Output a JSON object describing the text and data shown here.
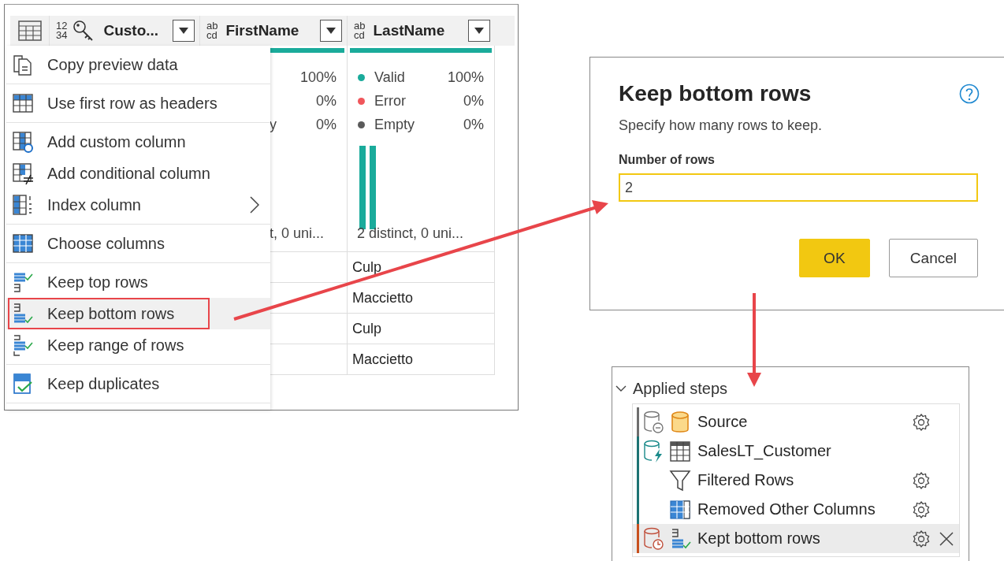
{
  "query_grid": {
    "columns": [
      {
        "type_lines": [
          "12",
          "34"
        ],
        "key": true,
        "name": "Custo..."
      },
      {
        "type_lines": [
          "ab",
          "cd"
        ],
        "key": false,
        "name": "FirstName",
        "quality": [
          {
            "pct": "100%"
          },
          {
            "pct": "0%"
          },
          {
            "label": "y",
            "pct": "0%"
          }
        ],
        "distinct": "t, 0 uni..."
      },
      {
        "type_lines": [
          "ab",
          "cd"
        ],
        "key": false,
        "name": "LastName",
        "quality": [
          {
            "label": "Valid",
            "color": "#1aab9b",
            "pct": "100%"
          },
          {
            "label": "Error",
            "color": "#f0565b",
            "pct": "0%"
          },
          {
            "label": "Empty",
            "color": "#5a5a5a",
            "pct": "0%"
          }
        ],
        "distinct": "2 distinct, 0 uni...",
        "cells": [
          "Culp",
          "Maccietto",
          "Culp",
          "Maccietto"
        ]
      }
    ]
  },
  "context_menu": {
    "groups": [
      [
        {
          "kind": "copy",
          "label": "Copy preview data",
          "submenu": false,
          "selected": false
        }
      ],
      [
        {
          "kind": "headers",
          "label": "Use first row as headers",
          "submenu": false,
          "selected": false
        }
      ],
      [
        {
          "kind": "custom",
          "label": "Add custom column",
          "submenu": false,
          "selected": false
        },
        {
          "kind": "conditional",
          "label": "Add conditional column",
          "submenu": false,
          "selected": false
        },
        {
          "kind": "index",
          "label": "Index column",
          "submenu": true,
          "selected": false
        }
      ],
      [
        {
          "kind": "choose",
          "label": "Choose columns",
          "submenu": false,
          "selected": false
        }
      ],
      [
        {
          "kind": "keep-top",
          "label": "Keep top rows",
          "submenu": false,
          "selected": false
        },
        {
          "kind": "keep-bottom",
          "label": "Keep bottom rows",
          "submenu": false,
          "selected": true
        },
        {
          "kind": "keep-range",
          "label": "Keep range of rows",
          "submenu": false,
          "selected": false
        }
      ],
      [
        {
          "kind": "duplicates",
          "label": "Keep duplicates",
          "submenu": false,
          "selected": false
        }
      ]
    ]
  },
  "dialog": {
    "title": "Keep bottom rows",
    "description": "Specify how many rows to keep.",
    "field_label": "Number of rows",
    "value": "2",
    "buttons": [
      {
        "label": "OK",
        "primary": true
      },
      {
        "label": "Cancel",
        "primary": false
      }
    ]
  },
  "applied_steps": {
    "title": "Applied steps",
    "expanded": true,
    "steps": [
      {
        "status": {
          "kind": "minus"
        },
        "kind": "source",
        "label": "Source",
        "settings": true,
        "selected": false,
        "color": "#6e6e6e"
      },
      {
        "status": {
          "kind": "bolt"
        },
        "kind": "navigation",
        "label": "SalesLT_Customer",
        "settings": false,
        "selected": false,
        "color": "#1d7373"
      },
      {
        "kind": "filter",
        "label": "Filtered Rows",
        "settings": true,
        "selected": false,
        "color": "#1d7373"
      },
      {
        "kind": "columns",
        "label": "Removed Other Columns",
        "settings": true,
        "selected": false,
        "color": "#1d7373"
      },
      {
        "status": {
          "kind": "clock"
        },
        "kind": "keep-bottom",
        "label": "Kept bottom rows",
        "settings": true,
        "selected": true,
        "color": "#c8501e"
      }
    ]
  }
}
